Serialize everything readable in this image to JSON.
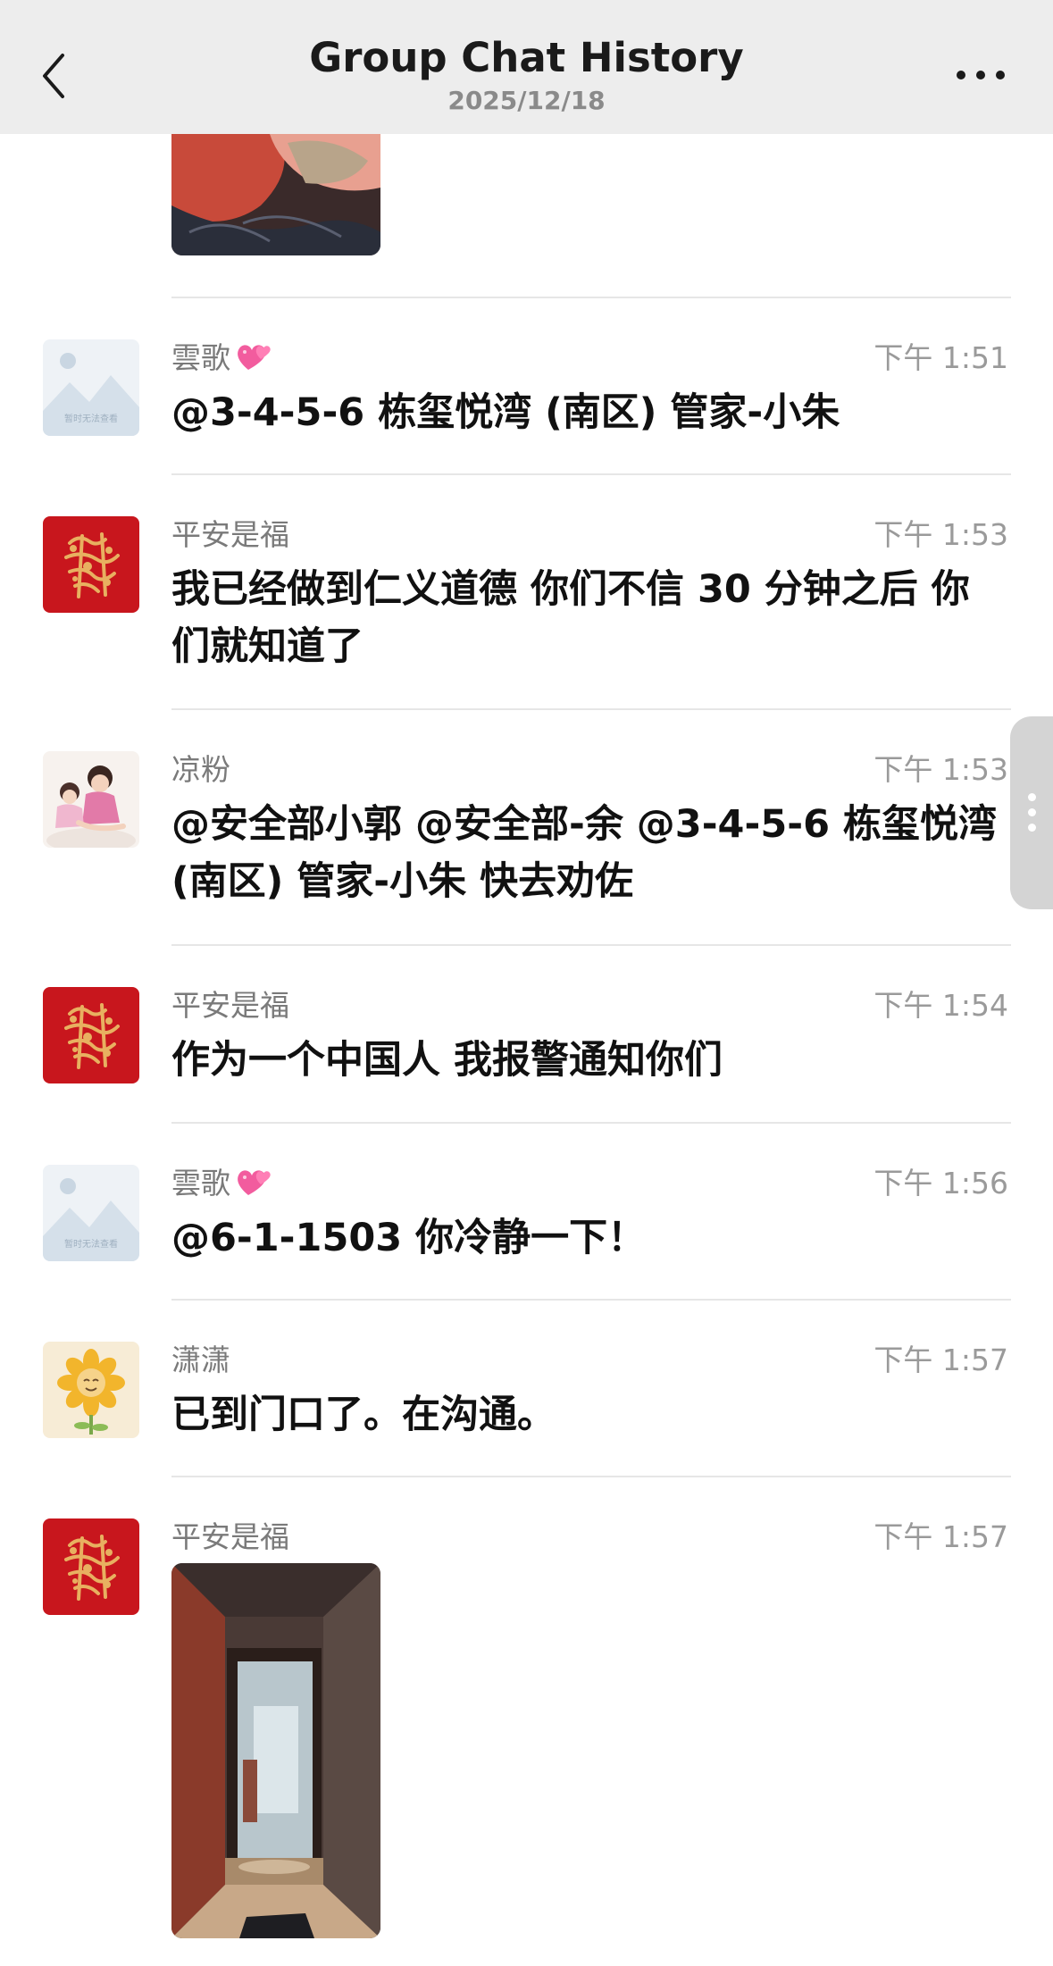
{
  "header": {
    "title": "Group Chat History",
    "date": "2025/12/18"
  },
  "messages": [
    {
      "sender": "雲歌",
      "time": "下午 1:51",
      "text": "@3-4-5-6 栋玺悦湾 (南区) 管家-小朱",
      "avatar_caption": "暂时无法查看",
      "sender_emoji": "heart-icon"
    },
    {
      "sender": "平安是福",
      "time": "下午 1:53",
      "text": "我已经做到仁义道德 你们不信 30 分钟之后 你们就知道了"
    },
    {
      "sender": "凉粉",
      "time": "下午 1:53",
      "text": "@安全部小郭 @安全部-余 @3-4-5-6 栋玺悦湾 (南区) 管家-小朱 快去劝佐"
    },
    {
      "sender": "平安是福",
      "time": "下午 1:54",
      "text": "作为一个中国人 我报警通知你们"
    },
    {
      "sender": "雲歌",
      "time": "下午 1:56",
      "text": "@6-1-1503 你冷静一下！",
      "avatar_caption": "暂时无法查看",
      "sender_emoji": "heart-icon"
    },
    {
      "sender": "潇潇",
      "time": "下午 1:57",
      "text": "已到门口了。在沟通。"
    },
    {
      "sender": "平安是福",
      "time": "下午 1:57"
    }
  ],
  "colors": {
    "header_bg": "#ededed",
    "red_avatar": "#c8161d",
    "gold": "#e8b060",
    "divider": "#e6e6e6",
    "heart": "#f25c9e"
  }
}
